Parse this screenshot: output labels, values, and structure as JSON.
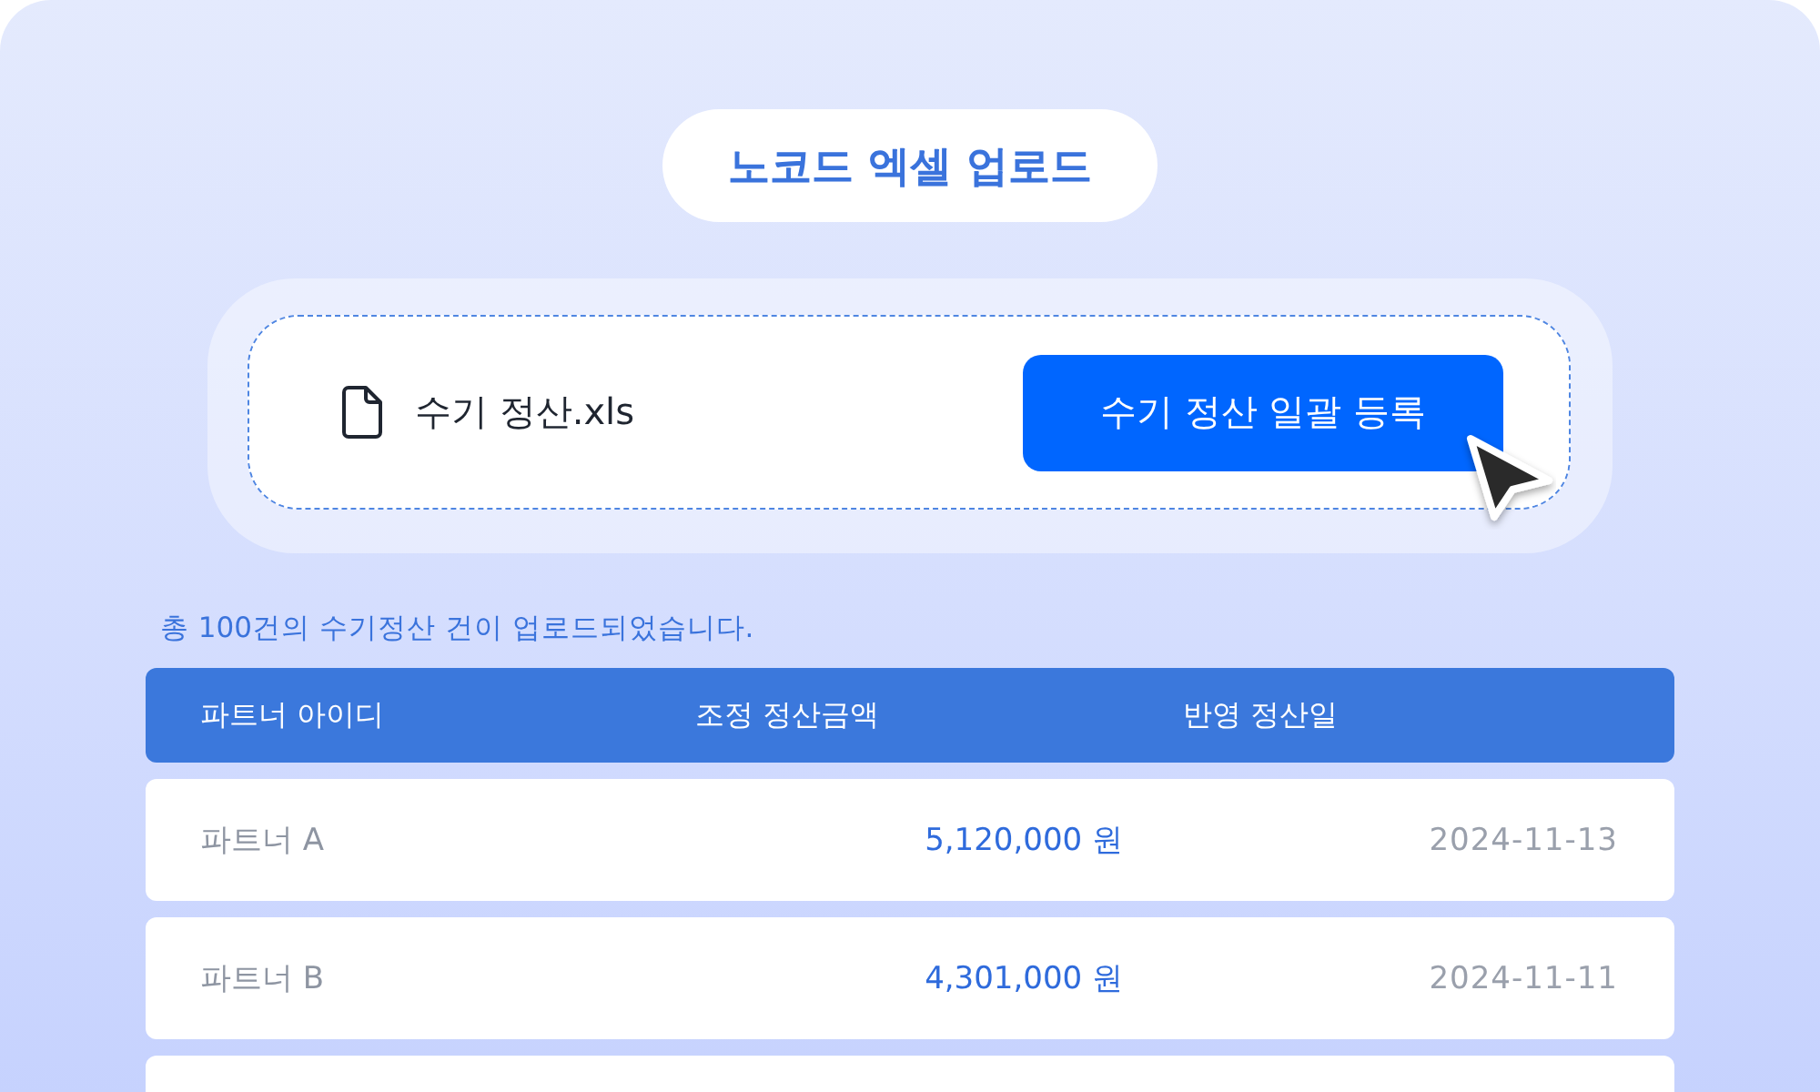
{
  "title_badge": "노코드 엑셀 업로드",
  "upload": {
    "file_name": "수기 정산.xls",
    "button": "수기 정산 일괄 등록"
  },
  "message": "총 100건의 수기정산 건이 업로드되었습니다.",
  "table": {
    "columns": [
      "파트너 아이디",
      "조정 정산금액",
      "반영 정산일"
    ],
    "rows": [
      {
        "partner": "파트너 A",
        "amount": "5,120,000 원",
        "date": "2024-11-13"
      },
      {
        "partner": "파트너 B",
        "amount": "4,301,000 원",
        "date": "2024-11-11"
      }
    ],
    "more_rows_below": true
  }
}
